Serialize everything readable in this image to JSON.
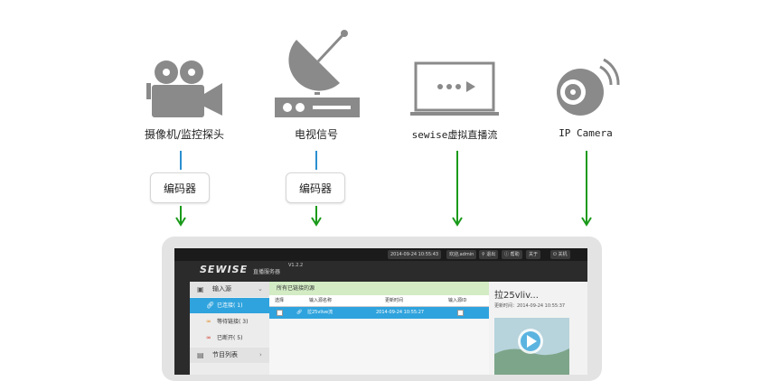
{
  "sources": [
    {
      "label": "摄像机/监控探头",
      "icon": "video-camera-icon"
    },
    {
      "label": "电视信号",
      "icon": "satellite-dish-icon"
    },
    {
      "label": "sewise虚拟直播流",
      "icon": "monitor-play-icon"
    },
    {
      "label": "IP Camera",
      "icon": "ip-camera-icon"
    }
  ],
  "encoders": [
    {
      "label": "编码器"
    },
    {
      "label": "编码器"
    }
  ],
  "colors": {
    "line_blue": "#2b8fd0",
    "arrow_green": "#1a9a1a",
    "accent": "#2fa3dd",
    "crumb_green": "#d3ecc4"
  },
  "app": {
    "brand": "SEWISE",
    "brand_sub": "直播服务器",
    "version": "V1.2.2",
    "topbar": {
      "datetime": "2014-09-24 10:55:43",
      "welcome": "欢迎,admin",
      "logout": "退出",
      "help": "帮助",
      "about": "关于",
      "shutdown": "关机"
    },
    "sidebar": {
      "input_source": "输入源",
      "items": [
        {
          "label": "已连接( 1)"
        },
        {
          "label": "等待链接( 3)"
        },
        {
          "label": "已断开( 5)"
        }
      ],
      "program_list": "节目列表"
    },
    "content": {
      "breadcrumb": "所有已链接的源",
      "columns": [
        "选择",
        "输入源名称",
        "更新时间",
        "输入源ID"
      ],
      "rows": [
        {
          "name": "拉25vlive流",
          "time": "2014-09-24 10:55:27"
        }
      ]
    },
    "preview": {
      "title": "拉25vliv...",
      "time": "更新时间：2014-09-24 10:55:37"
    }
  }
}
